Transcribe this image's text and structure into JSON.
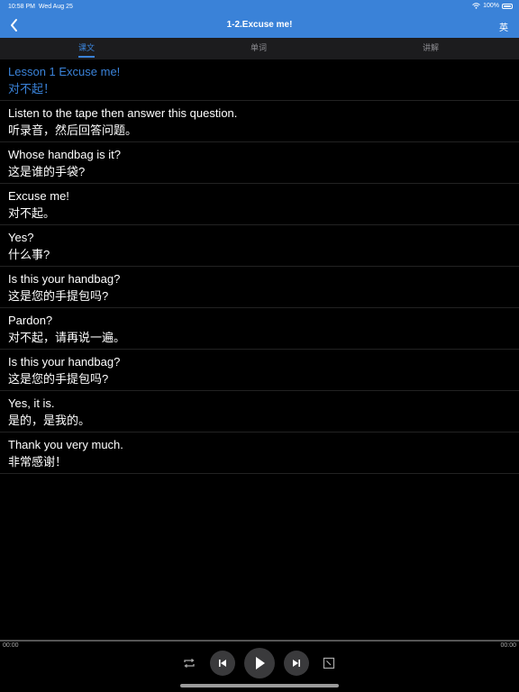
{
  "status_bar": {
    "time": "10:58 PM",
    "date": "Wed Aug 25",
    "battery": "100%"
  },
  "nav": {
    "title": "1-2.Excuse me!",
    "lang_button": "英",
    "back_icon": "chevron-left-icon"
  },
  "tabs": [
    {
      "label": "课文",
      "active": true
    },
    {
      "label": "单词",
      "active": false
    },
    {
      "label": "讲解",
      "active": false
    }
  ],
  "sentences": [
    {
      "en": "Lesson 1 Excuse me!",
      "cn": "对不起！"
    },
    {
      "en": "Listen to the tape then answer this question.",
      "cn": "听录音，然后回答问题。"
    },
    {
      "en": "Whose handbag is it?",
      "cn": "这是谁的手袋?"
    },
    {
      "en": "Excuse me!",
      "cn": "对不起。"
    },
    {
      "en": "Yes?",
      "cn": "什么事?"
    },
    {
      "en": "Is this your handbag?",
      "cn": "这是您的手提包吗?"
    },
    {
      "en": "Pardon?",
      "cn": "对不起，请再说一遍。"
    },
    {
      "en": "Is this your handbag?",
      "cn": "这是您的手提包吗?"
    },
    {
      "en": "Yes, it is.",
      "cn": "是的，是我的。"
    },
    {
      "en": "Thank you very much.",
      "cn": "非常感谢！"
    }
  ],
  "player": {
    "current_time": "00:00",
    "total_time": "00:00",
    "progress": 0
  },
  "colors": {
    "accent": "#3a82d8",
    "background": "#000000",
    "tab_bar": "#1c1c1e"
  }
}
